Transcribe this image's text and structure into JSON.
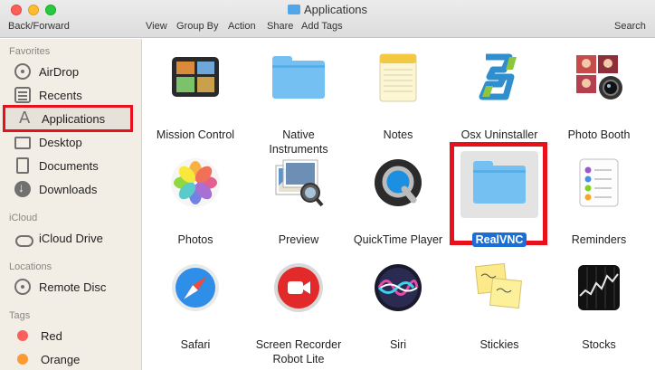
{
  "window": {
    "title": "Applications"
  },
  "toolbar": {
    "back_forward": "Back/Forward",
    "view": "View",
    "group_by": "Group By",
    "action": "Action",
    "share": "Share",
    "add_tags": "Add Tags",
    "search": "Search"
  },
  "sidebar": {
    "favorites_header": "Favorites",
    "icloud_header": "iCloud",
    "locations_header": "Locations",
    "tags_header": "Tags",
    "items": [
      {
        "label": "AirDrop",
        "icon": "airdrop-icon"
      },
      {
        "label": "Recents",
        "icon": "recents-icon"
      },
      {
        "label": "Applications",
        "icon": "applications-icon",
        "selected": true
      },
      {
        "label": "Desktop",
        "icon": "desktop-icon"
      },
      {
        "label": "Documents",
        "icon": "documents-icon"
      },
      {
        "label": "Downloads",
        "icon": "downloads-icon"
      },
      {
        "label": "iCloud Drive",
        "icon": "cloud-icon"
      },
      {
        "label": "Remote Disc",
        "icon": "disc-icon"
      },
      {
        "label": "Red",
        "icon": "tag-red-icon",
        "color": "#fc605c"
      },
      {
        "label": "Orange",
        "icon": "tag-orange-icon",
        "color": "#fd9a35"
      }
    ]
  },
  "apps": [
    {
      "label": "Mission Control",
      "icon": "mission-control-icon"
    },
    {
      "label": "Native\nInstruments",
      "icon": "folder-icon"
    },
    {
      "label": "Notes",
      "icon": "notes-icon"
    },
    {
      "label": "Osx Uninstaller",
      "icon": "osx-uninstaller-icon"
    },
    {
      "label": "Photo Booth",
      "icon": "photo-booth-icon"
    },
    {
      "label": "Photos",
      "icon": "photos-icon"
    },
    {
      "label": "Preview",
      "icon": "preview-icon"
    },
    {
      "label": "QuickTime Player",
      "icon": "quicktime-icon"
    },
    {
      "label": "RealVNC",
      "icon": "folder-icon",
      "selected": true
    },
    {
      "label": "Reminders",
      "icon": "reminders-icon"
    },
    {
      "label": "Safari",
      "icon": "safari-icon"
    },
    {
      "label": "Screen Recorder\nRobot Lite",
      "icon": "screen-recorder-icon"
    },
    {
      "label": "Siri",
      "icon": "siri-icon"
    },
    {
      "label": "Stickies",
      "icon": "stickies-icon"
    },
    {
      "label": "Stocks",
      "icon": "stocks-icon"
    }
  ],
  "colors": {
    "selection_highlight": "#e8101a",
    "selected_label_bg": "#1a6fd6",
    "folder_blue": "#74c0f2"
  }
}
